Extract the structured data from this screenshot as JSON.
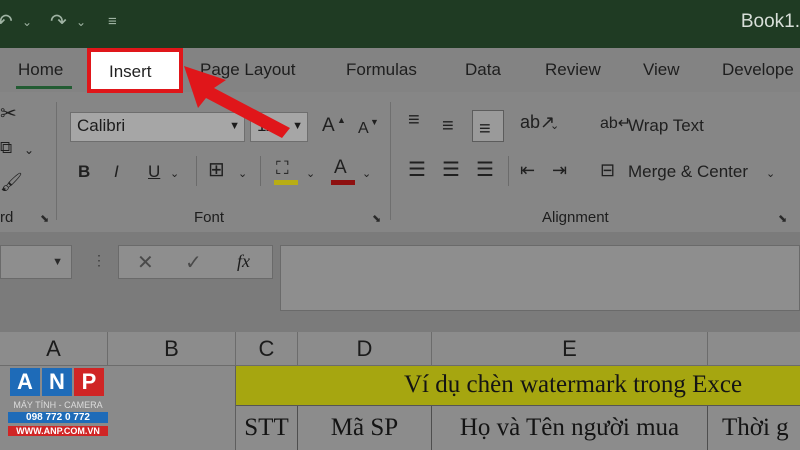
{
  "titlebar": {
    "undo_icon": "undo-icon",
    "redo_icon": "redo-icon",
    "customize_icon": "customize-quick-access-icon",
    "book_title": "Book1."
  },
  "tabs": {
    "home": "Home",
    "insert": "Insert",
    "page_layout": "Page Layout",
    "formulas": "Formulas",
    "data": "Data",
    "review": "Review",
    "view": "View",
    "developer": "Develope"
  },
  "ribbon": {
    "clipboard_label": "rd",
    "font": {
      "name": "Calibri",
      "size": "11",
      "grow": "A",
      "shrink": "A",
      "bold": "B",
      "italic": "I",
      "underline": "U",
      "font_color_letter": "A",
      "label": "Font"
    },
    "alignment": {
      "wrap_text": "Wrap Text",
      "merge_center": "Merge & Center",
      "label": "Alignment"
    }
  },
  "formula_bar": {
    "cancel": "✕",
    "enter": "✓",
    "fx": "fx"
  },
  "grid": {
    "columns": [
      "A",
      "B",
      "C",
      "D",
      "E"
    ],
    "title_cell": "Ví dụ chèn watermark trong Exce",
    "headers": [
      "STT",
      "Mã SP",
      "Họ và Tên người mua",
      "Thời g"
    ]
  },
  "logo": {
    "letters": [
      "A",
      "N",
      "P"
    ],
    "tagline": "MÁY TÍNH - CAMERA",
    "phone": "098 772 0 772",
    "website": "WWW.ANP.COM.VN"
  },
  "colors": {
    "highlight": "#e0161a",
    "accent": "#235c33"
  }
}
